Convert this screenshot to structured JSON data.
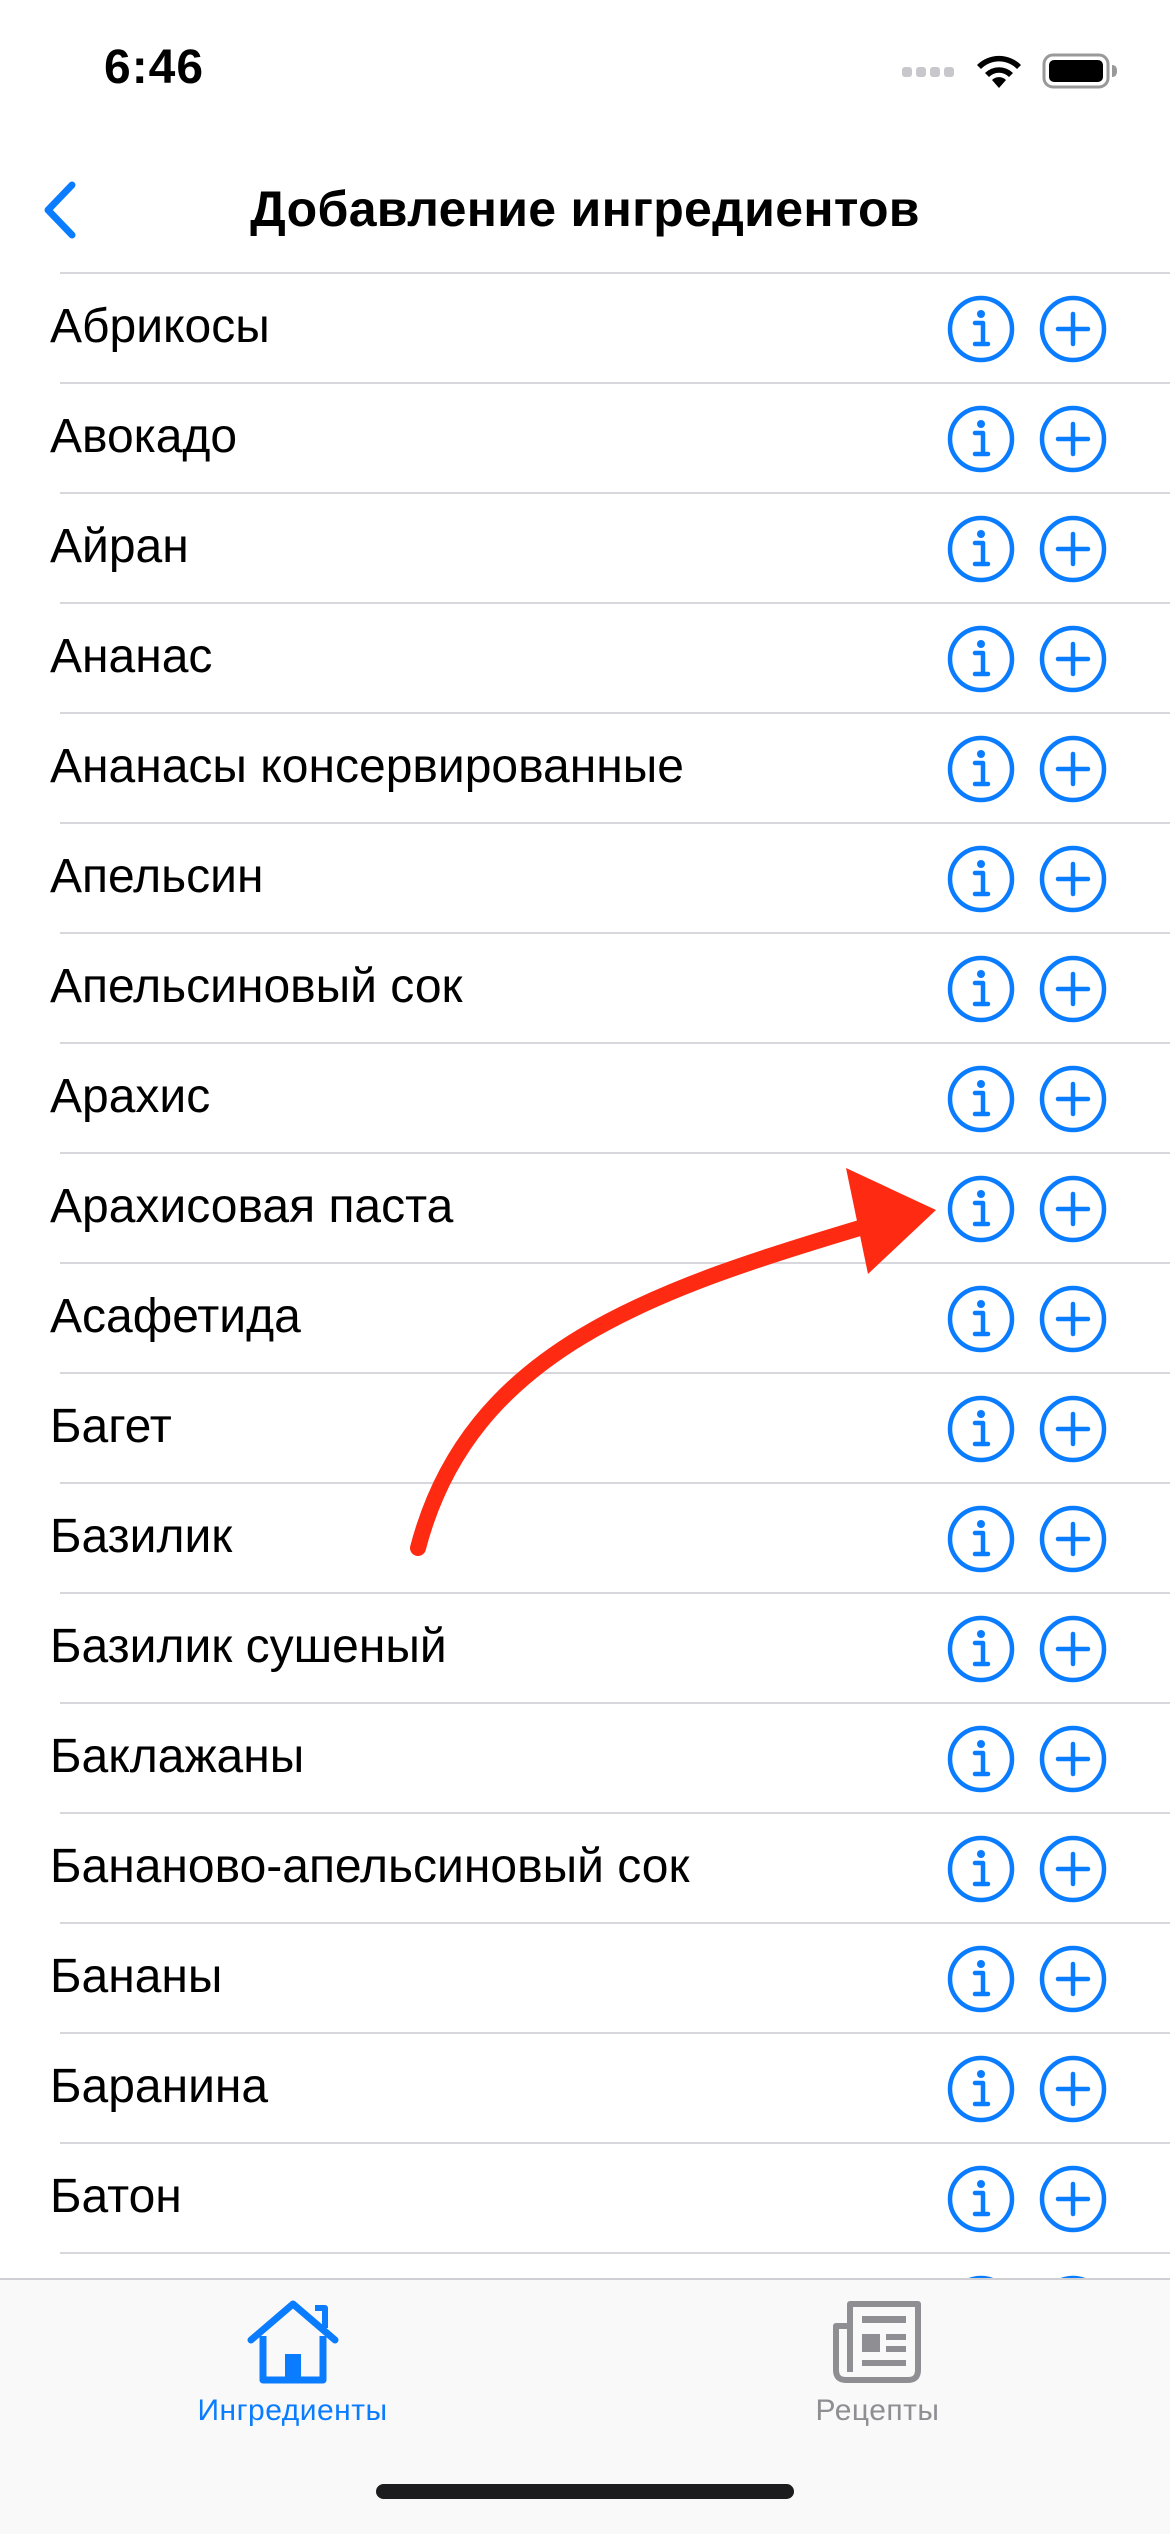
{
  "status_bar": {
    "time": "6:46"
  },
  "nav": {
    "title": "Добавление ингредиентов",
    "back_icon": "chevron-left-icon"
  },
  "colors": {
    "accent": "#0a7cff",
    "annotation_arrow": "#ff2a12",
    "inactive_tab": "#8e8e93"
  },
  "ingredients": [
    {
      "label": "Абрикосы"
    },
    {
      "label": "Авокадо"
    },
    {
      "label": "Айран"
    },
    {
      "label": "Ананас"
    },
    {
      "label": "Ананасы консервированные"
    },
    {
      "label": "Апельсин"
    },
    {
      "label": "Апельсиновый сок"
    },
    {
      "label": "Арахис"
    },
    {
      "label": "Арахисовая паста"
    },
    {
      "label": "Асафетида"
    },
    {
      "label": "Багет"
    },
    {
      "label": "Базилик"
    },
    {
      "label": "Базилик сушеный"
    },
    {
      "label": "Баклажаны"
    },
    {
      "label": "Бананово-апельсиновый сок"
    },
    {
      "label": "Бананы"
    },
    {
      "label": "Баранина"
    },
    {
      "label": "Батон"
    },
    {
      "label": ""
    }
  ],
  "row_icons": {
    "info": "info-circle-icon",
    "add": "plus-circle-icon"
  },
  "tab_bar": {
    "tabs": [
      {
        "label": "Ингредиенты",
        "icon": "house-icon",
        "selected": true
      },
      {
        "label": "Рецепты",
        "icon": "newspaper-icon",
        "selected": false
      }
    ]
  }
}
